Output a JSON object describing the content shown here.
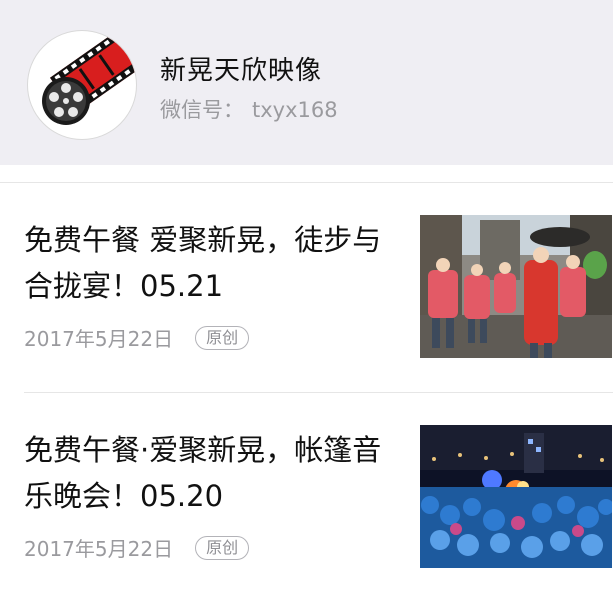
{
  "account": {
    "name": "新晃天欣映像",
    "id_label": "微信号：",
    "id_value": "txyx168"
  },
  "articles": [
    {
      "title": "免费午餐 爱聚新晃，徒步与合拢宴！05.21",
      "date": "2017年5月22日",
      "tag": "原创"
    },
    {
      "title": "免费午餐·爱聚新晃，帐篷音乐晚会！05.20",
      "date": "2017年5月22日",
      "tag": "原创"
    }
  ],
  "colors": {
    "header_bg": "#efeef3",
    "logo_red": "#d81e1e",
    "secondary_text": "#9a9a9e"
  }
}
